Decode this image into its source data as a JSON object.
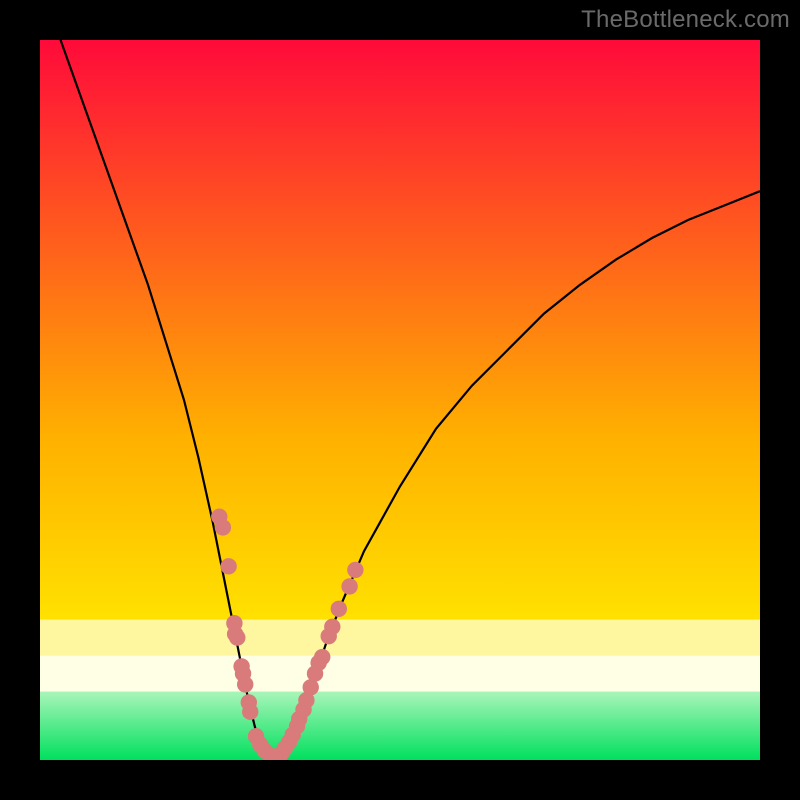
{
  "watermark": "TheBottleneck.com",
  "colors": {
    "bg_black": "#000000",
    "grad_top": "#ff0a3a",
    "grad_mid": "#ffd400",
    "grad_pale_band_top": "#fff7a0",
    "grad_pale_band_bot": "#ffffe6",
    "grad_green_top": "#a9f5b9",
    "grad_green_bot": "#00e05e",
    "curve": "#000000",
    "dot_fill": "#d97b7b",
    "dot_stroke": "#c46868"
  },
  "chart_data": {
    "type": "line",
    "title": "",
    "xlabel": "",
    "ylabel": "",
    "xlim": [
      0,
      100
    ],
    "ylim": [
      0,
      100
    ],
    "series": [
      {
        "name": "bottleneck-curve",
        "x": [
          0,
          5,
          10,
          15,
          20,
          22,
          24,
          26,
          27,
          28,
          29,
          30,
          31,
          32,
          33,
          34,
          35,
          36,
          38,
          40,
          42,
          45,
          50,
          55,
          60,
          65,
          70,
          75,
          80,
          85,
          90,
          95,
          100
        ],
        "y": [
          108,
          94,
          80,
          66,
          50,
          42,
          33,
          23,
          18,
          13,
          8,
          4,
          1.5,
          0.5,
          0.5,
          1.5,
          3.5,
          6,
          11,
          17,
          22,
          29,
          38,
          46,
          52,
          57,
          62,
          66,
          69.5,
          72.5,
          75,
          77,
          79
        ]
      }
    ],
    "scatter": [
      {
        "name": "left-cluster",
        "points": [
          [
            24.9,
            33.8
          ],
          [
            25.4,
            32.3
          ],
          [
            26.2,
            26.9
          ],
          [
            27.0,
            19.0
          ],
          [
            27.1,
            17.5
          ],
          [
            27.4,
            17.0
          ],
          [
            28.0,
            13.0
          ],
          [
            28.2,
            12.0
          ],
          [
            28.5,
            10.5
          ],
          [
            29.0,
            8.0
          ],
          [
            29.2,
            6.7
          ]
        ]
      },
      {
        "name": "valley-cluster",
        "points": [
          [
            30.0,
            3.3
          ],
          [
            30.6,
            2.1
          ],
          [
            31.2,
            1.3
          ],
          [
            32.0,
            0.6
          ],
          [
            32.8,
            0.5
          ],
          [
            33.5,
            0.9
          ],
          [
            34.0,
            1.6
          ],
          [
            34.6,
            2.5
          ],
          [
            35.1,
            3.5
          ],
          [
            35.7,
            4.7
          ],
          [
            36.0,
            5.7
          ]
        ]
      },
      {
        "name": "right-cluster",
        "points": [
          [
            36.6,
            7.0
          ],
          [
            37.0,
            8.3
          ],
          [
            37.6,
            10.1
          ],
          [
            38.2,
            12.0
          ],
          [
            38.7,
            13.5
          ],
          [
            39.2,
            14.3
          ],
          [
            40.1,
            17.2
          ],
          [
            40.6,
            18.5
          ],
          [
            41.5,
            21.0
          ],
          [
            43.0,
            24.1
          ],
          [
            43.8,
            26.4
          ]
        ]
      }
    ],
    "bands": [
      {
        "name": "pale-yellow-band",
        "y0": 19.5,
        "y1": 14.5
      },
      {
        "name": "off-white-band",
        "y0": 14.5,
        "y1": 9.5
      },
      {
        "name": "green-gradient",
        "y0": 9.5,
        "y1": 0
      }
    ]
  }
}
